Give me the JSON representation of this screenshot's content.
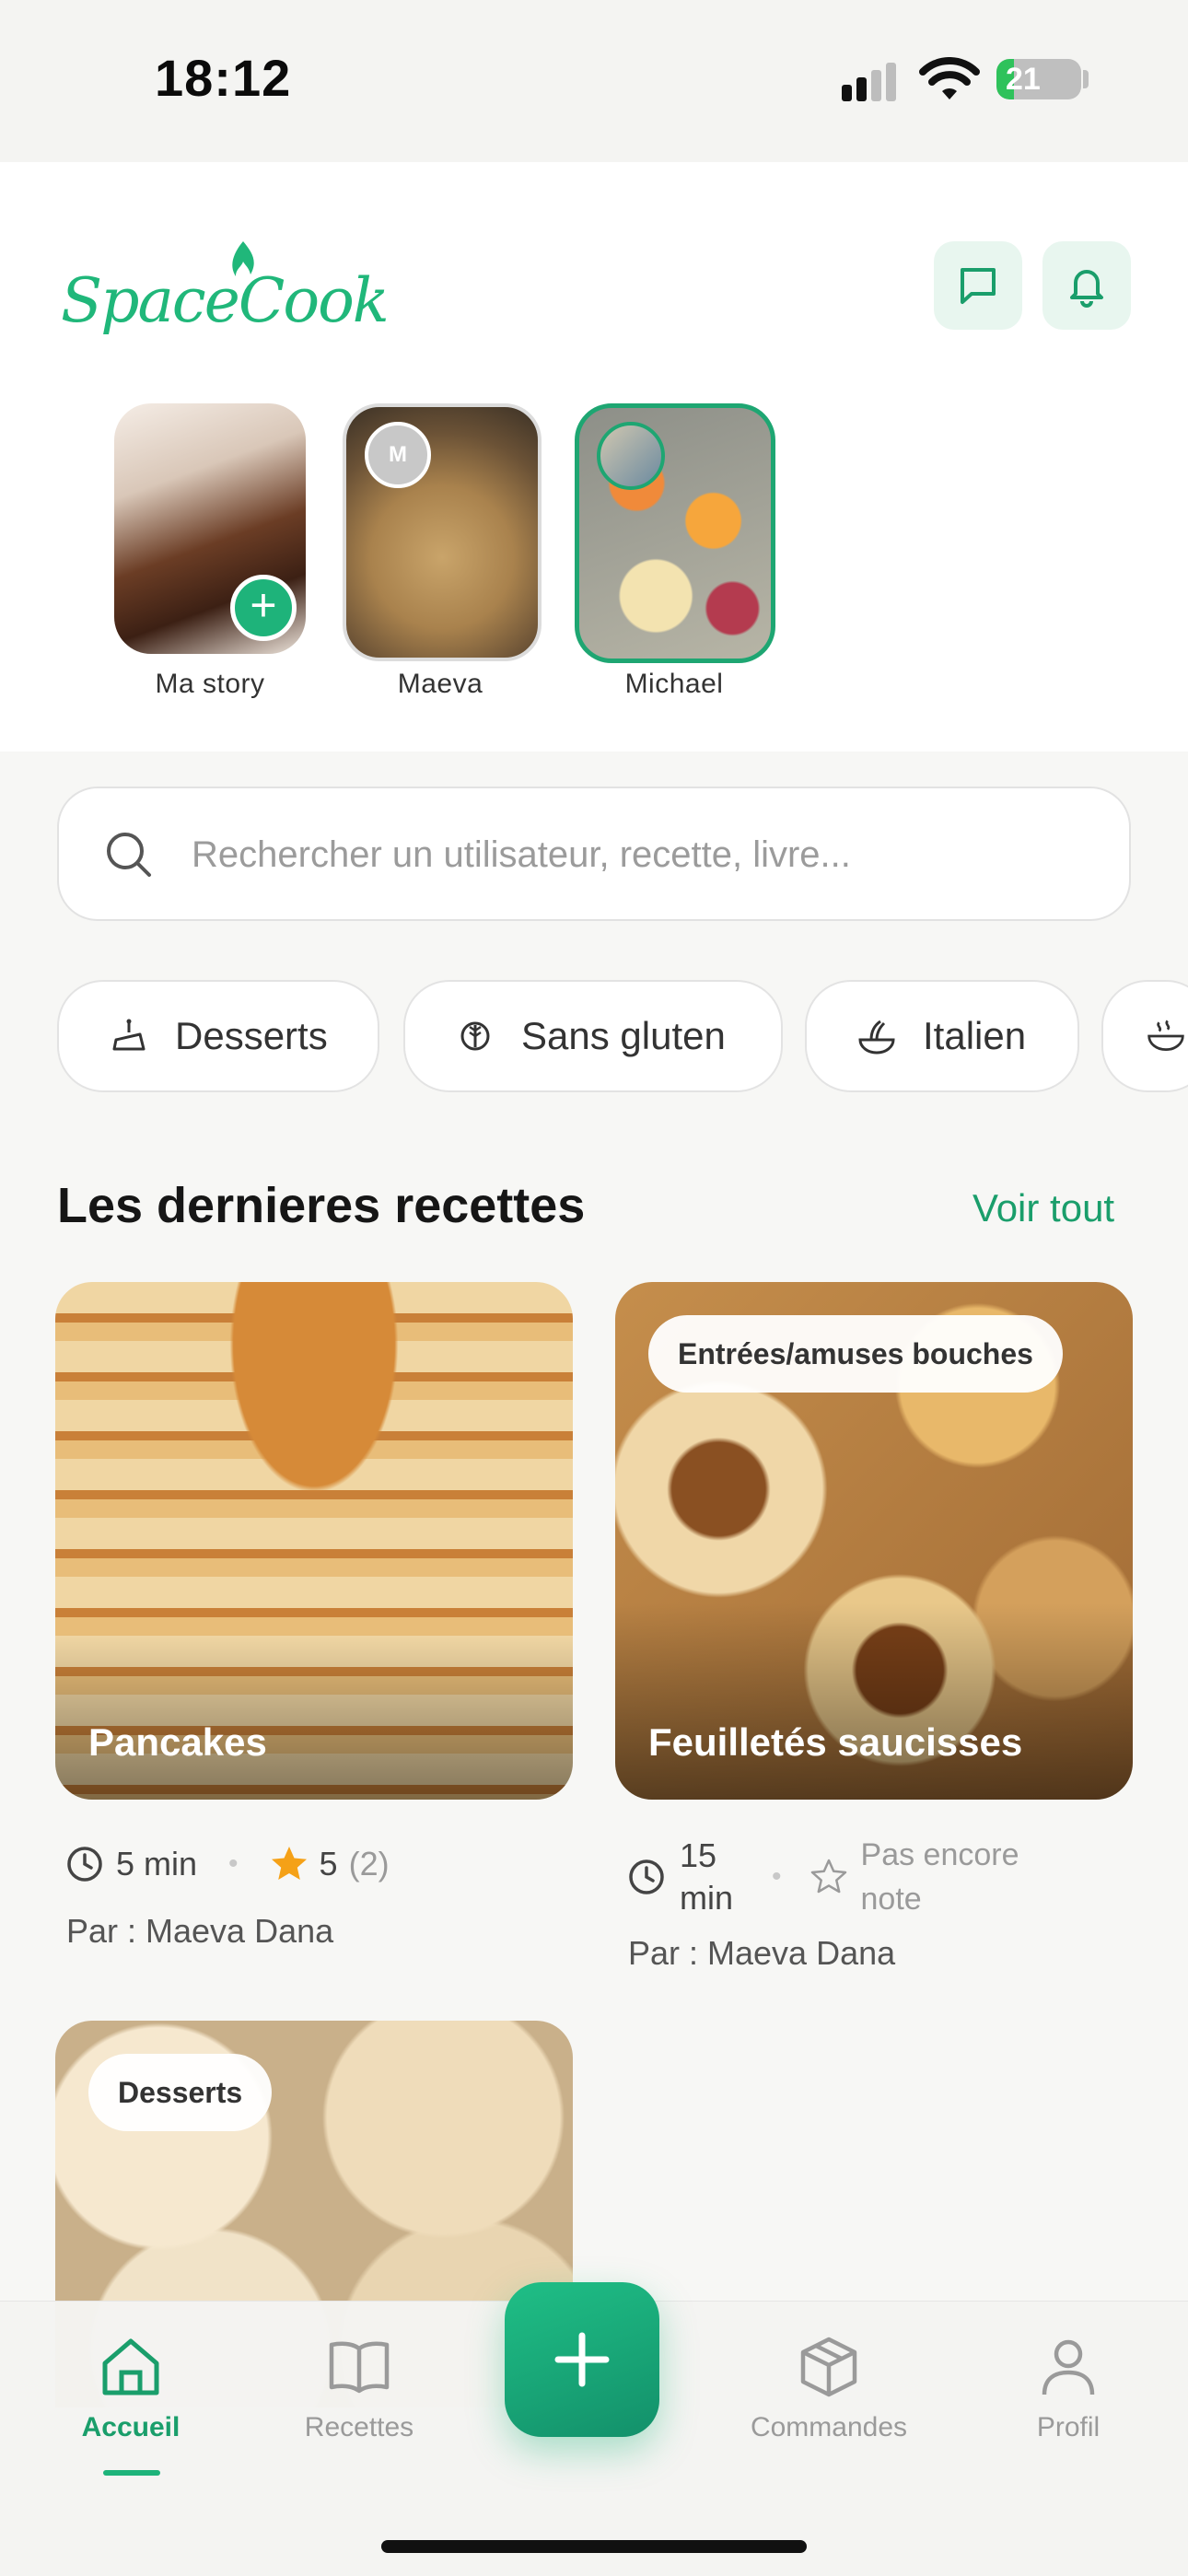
{
  "status_bar": {
    "time": "18:12",
    "battery": "21",
    "battery_level_pct": 21
  },
  "header": {
    "logo_text": "SpaceCook"
  },
  "stories": [
    {
      "label": "Ma story"
    },
    {
      "label": "Maeva",
      "avatar_initial": "M"
    },
    {
      "label": "Michael"
    }
  ],
  "search": {
    "placeholder": "Rechercher un utilisateur, recette, livre..."
  },
  "categories": [
    {
      "label": "Desserts",
      "icon": "cake-icon"
    },
    {
      "label": "Sans gluten",
      "icon": "wheat-icon"
    },
    {
      "label": "Italien",
      "icon": "pasta-icon"
    },
    {
      "label": "",
      "icon": "soup-bowl-icon"
    }
  ],
  "section": {
    "title": "Les dernieres recettes",
    "see_all": "Voir tout"
  },
  "recipes": [
    {
      "title": "Pancakes",
      "time": "5 min",
      "rating": "5",
      "rating_count": "(2)",
      "author": "Par : Maeva Dana"
    },
    {
      "title": "Feuilletés saucisses",
      "category": "Entrées/amuses bouches",
      "time_value": "15",
      "time_unit": "min",
      "rating_text_1": "Pas encore",
      "rating_text_2": "note",
      "author": "Par : Maeva Dana"
    },
    {
      "category": "Desserts"
    }
  ],
  "nav": {
    "home": "Accueil",
    "recipes": "Recettes",
    "orders": "Commandes",
    "profile": "Profil"
  },
  "colors": {
    "accent": "#1EB37A",
    "accent_dark": "#1A9E6B",
    "chip_bg": "#FFFFFF"
  }
}
